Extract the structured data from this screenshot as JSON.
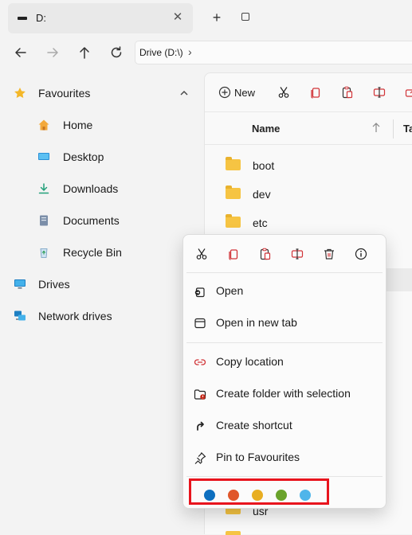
{
  "tab": {
    "title": "D:",
    "close_glyph": "✕"
  },
  "tabbar": {
    "new_tab_glyph": "+"
  },
  "nav": {
    "crumb": "Drive (D:\\)",
    "crumb_chevron": "›"
  },
  "sidebar": {
    "favourites": {
      "label": "Favourites",
      "icon": "star-icon"
    },
    "items": [
      {
        "label": "Home",
        "icon": "home-icon"
      },
      {
        "label": "Desktop",
        "icon": "desktop-icon"
      },
      {
        "label": "Downloads",
        "icon": "download-icon"
      },
      {
        "label": "Documents",
        "icon": "documents-icon"
      },
      {
        "label": "Recycle Bin",
        "icon": "recycle-bin-icon"
      }
    ],
    "drives": {
      "label": "Drives",
      "icon": "monitor-icon"
    },
    "network": {
      "label": "Network drives",
      "icon": "network-icon"
    }
  },
  "toolbar": {
    "new_label": "New"
  },
  "columns": {
    "name": "Name",
    "type": "Ta"
  },
  "files": [
    {
      "name": "boot"
    },
    {
      "name": "dev"
    },
    {
      "name": "etc"
    }
  ],
  "partial_file": "usr",
  "context_menu": {
    "items": [
      {
        "label": "Open",
        "icon": "open-icon"
      },
      {
        "label": "Open in new tab",
        "icon": "new-tab-icon"
      },
      {
        "label": "Copy location",
        "icon": "link-icon"
      },
      {
        "label": "Create folder with selection",
        "icon": "folder-add-icon"
      },
      {
        "label": "Create shortcut",
        "icon": "shortcut-icon"
      },
      {
        "label": "Pin to Favourites",
        "icon": "pin-icon"
      }
    ],
    "tag_colors": [
      "#0e6fbf",
      "#e0572b",
      "#e8ae22",
      "#6aa32c",
      "#4fb5ea"
    ]
  },
  "colors": {
    "accent_red": "#d13438",
    "highlight_box": "#e8141d"
  }
}
